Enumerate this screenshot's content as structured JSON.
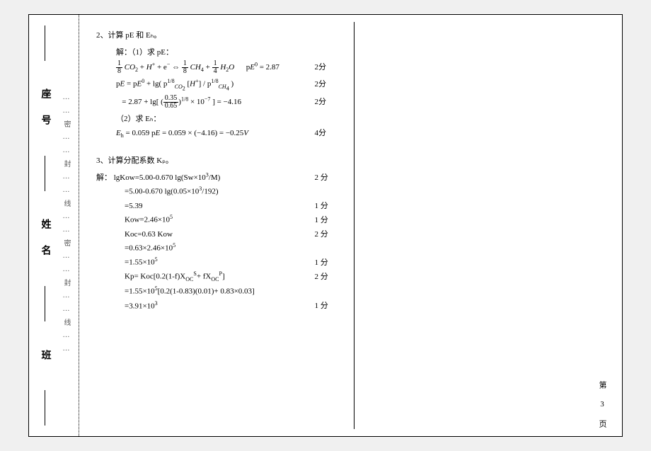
{
  "binding": {
    "vertical_dotted_text": "……密……封……线……密……封……线……",
    "labels": [
      "座 号",
      "姓 名",
      "班"
    ]
  },
  "problem2": {
    "title": "2、计算 pE 和 Eₕ。",
    "sol_label": "解：（1）求 pE：",
    "eq1_lhs": "⅛ CO₂ + H⁺ + e⁻ ⇔ ⅛ CH₄ + ¼ H₂O",
    "eq1_rhs": "pE⁰ = 2.87",
    "eq1_score": "2分",
    "eq2": "pE = pE⁰ + lg( p_CO₂^{1/8} [H⁺] / p_CH₄^{1/8} )",
    "eq2_score": "2分",
    "eq3": "= 2.87 + lg[ (0.35/0.65)^{1/8} × 10⁻⁷ ] = −4.16",
    "eq3_score": "2分",
    "sol2_label": "（2）求 Eₕ：",
    "eq4": "Eₕ = 0.059 pE = 0.059 × (−4.16) = −0.25V",
    "eq4_score": "4分"
  },
  "problem3": {
    "title": "3、计算分配系数 Kₚ。",
    "sol_label": "解：",
    "l1": "lgKow=5.00-0.670 lg(Sw×10³/M)",
    "l1_score": "2 分",
    "l2": "=5.00-0.670 lg(0.05×10³/192)",
    "l3": "=5.39",
    "l3_score": "1 分",
    "l4": "Kow=2.46×10⁵",
    "l4_score": "1 分",
    "l5": "Koc=0.63 Kow",
    "l5_score": "2 分",
    "l6": "=0.63×2.46×10⁵",
    "l7": "=1.55×10⁵",
    "l7_score": "1 分",
    "l8": "Kp= Koc[0.2(1-f)X_OC^S + fX_OC^P]",
    "l8_score": "2 分",
    "l9": "=1.55×10⁵[0.2(1-0.83)(0.01)+ 0.83×0.03]",
    "l10": "=3.91×10³",
    "l10_score": "1 分"
  },
  "page_number": "第 3 页"
}
